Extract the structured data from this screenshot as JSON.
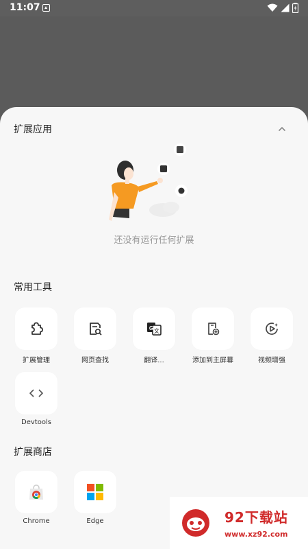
{
  "status_bar": {
    "time": "11:07"
  },
  "extensions_section": {
    "title": "扩展应用",
    "empty_text": "还没有运行任何扩展"
  },
  "tools_section": {
    "title": "常用工具",
    "items": [
      {
        "label": "扩展管理",
        "icon": "puzzle-icon"
      },
      {
        "label": "网页查找",
        "icon": "page-search-icon"
      },
      {
        "label": "翻译...",
        "icon": "translate-icon"
      },
      {
        "label": "添加到主屏幕",
        "icon": "add-to-home-icon"
      },
      {
        "label": "视频增强",
        "icon": "video-enhance-icon"
      },
      {
        "label": "Devtools",
        "icon": "code-icon"
      }
    ]
  },
  "store_section": {
    "title": "扩展商店",
    "items": [
      {
        "label": "Chrome",
        "icon": "chrome-store-icon"
      },
      {
        "label": "Edge",
        "icon": "edge-store-icon"
      }
    ]
  },
  "watermark": {
    "title": "92下载站",
    "url": "www.xz92.com"
  },
  "colors": {
    "sheet_bg": "#f7f7f7",
    "scrim": "#5b5b5b",
    "illustration_accent": "#f59a22",
    "watermark_red": "#d02a2a"
  }
}
